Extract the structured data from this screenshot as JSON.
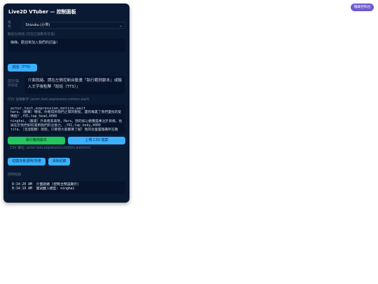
{
  "panel": {
    "title": "Live2D VTuber — 控制面板",
    "role_label": "角色",
    "role_value": "Shizuku (小雫)",
    "greeting_label": "歡迎台詞語 (可在已調整為可寫)",
    "greeting_text": "嗨嗨，歡迎來加入我們的討論！",
    "speak_button": "說話（TTS）",
    "hint_label": "提示/操作訊息",
    "hint_text": "介面就緒。請在左側控制台動畫「執行範例劇本」或輸入文字後點擊「說話（TTS）」",
    "csv_label": "CSV 逐筆數字 (actor,text,expression,motion,wait)",
    "csv_lines": [
      "actor,text,expression,motion,wait",
      "haru,（歡聲）嘿嗨，你看得到我們之間的輕鬆，還有嘴裏了我們還找的愛嗎啦？,f05,tap_head,4000",
      "ninghai,（嚴肅）外表看高表現，Haru，我的核心觀實是專注於目標，他與在於我們如何運用我們的注意力。,f01,tap_body,4000",
      "tita,（活潑開朗）嗯嗯，只要把大家都要了解！我的兒童還隨著所在喔"
    ],
    "run_button": "執行範例劇本",
    "upload_button": "上傳 CSV 檔案",
    "csv_format": "CSV 欄位: actor,text,expression,motion,wait(ms)",
    "toggle_bg_button": "切換背景透明/背景",
    "clear_log_button": "清除紀錄",
    "log_label": "控制紀錄",
    "log_entries": [
      {
        "time": "8:14:20 AM",
        "msg": "介面就緒 (控制台預設顯示)"
      },
      {
        "time": "8:14:19 AM",
        "msg": "嘗試載入模型: ninghai"
      }
    ]
  },
  "toggle_panel_button": "隱藏控制台",
  "colors": {
    "panel_bg": "#0b1a33",
    "accent_blue": "#3bb0ff",
    "accent_green": "#22c55e",
    "toggle_purple": "#6d5bd0"
  }
}
